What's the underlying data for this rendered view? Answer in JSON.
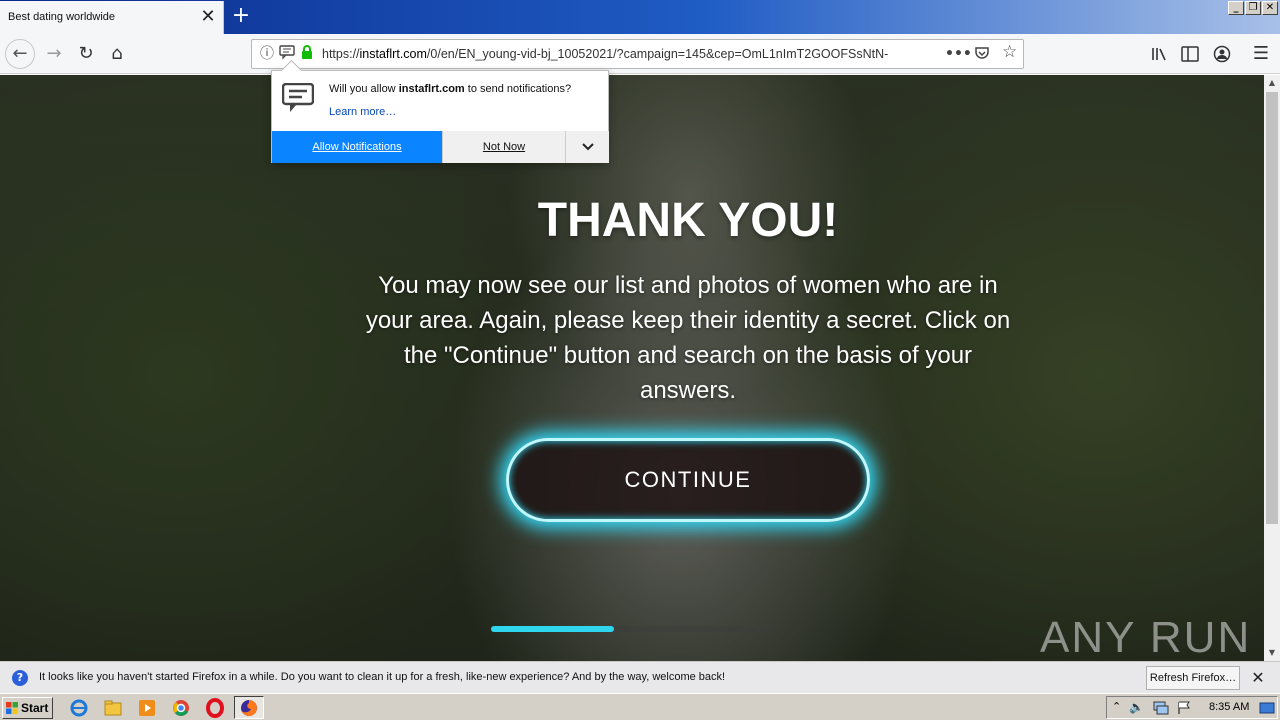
{
  "browser": {
    "tab_title": "Best dating worldwide",
    "url_prefix": "https://",
    "url_domain": "instaflrt.com",
    "url_rest": "/0/en/EN_young-vid-bj_10052021/?campaign=145&cep=OmL1nImT2GOOFSsNtN-"
  },
  "notification_popup": {
    "message_pre": "Will you allow ",
    "message_domain": "instaflrt.com",
    "message_post": " to send notifications?",
    "learn_more": "Learn more…",
    "allow_label": "Allow Notifications",
    "not_now_label": "Not Now"
  },
  "page": {
    "headline": "THANK YOU!",
    "body": "You may now see our list and photos of women who are in your area. Again, please keep their identity a secret. Click on the \"Continue\" button and search on the basis of your answers.",
    "continue_label": "CONTINUE",
    "progress_fraction": 0.44,
    "watermark": "ANY RUN"
  },
  "infobar": {
    "message": "It looks like you haven't started Firefox in a while. Do you want to clean it up for a fresh, like-new experience? And by the way, welcome back!",
    "refresh_label": "Refresh Firefox…"
  },
  "taskbar": {
    "start_label": "Start",
    "clock": "8:35 AM"
  },
  "colors": {
    "allow_button": "#0a84ff",
    "button_glow": "#32e0ff",
    "progress": "#2fd6ee"
  }
}
